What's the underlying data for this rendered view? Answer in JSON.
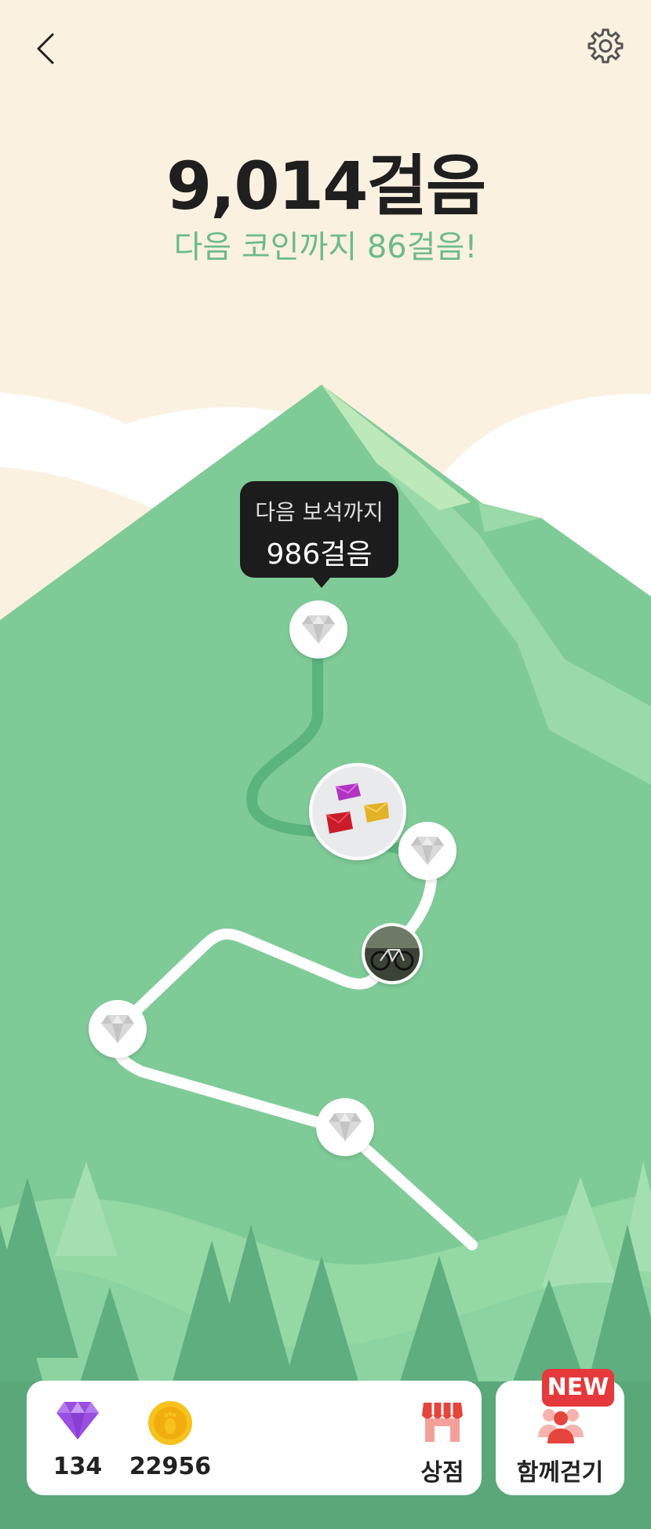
{
  "header": {
    "back_icon": "chevron-left-icon",
    "settings_icon": "gear-icon",
    "steps": "9,014걸음",
    "coin_message": "다음 코인까지 86걸음!"
  },
  "tooltip": {
    "line1": "다음 보석까지",
    "line2": "986걸음"
  },
  "path_nodes": [
    {
      "type": "gem",
      "state": "locked"
    },
    {
      "type": "photo",
      "subject": "colorful pouches"
    },
    {
      "type": "gem",
      "state": "locked"
    },
    {
      "type": "photo",
      "subject": "bicycle"
    },
    {
      "type": "gem",
      "state": "locked"
    },
    {
      "type": "gem",
      "state": "locked"
    }
  ],
  "bottom_bar": {
    "gems": "134",
    "coins": "22956",
    "shop_label": "상점",
    "walk_together_label": "함께걷기",
    "new_badge": "NEW"
  },
  "colors": {
    "sky": "#fbf1e0",
    "mountain": "#7fcb97",
    "gem_purple": "#9b4fe0",
    "coin_gold": "#f6c21c",
    "badge_red": "#e5393b",
    "accent_green": "#6dba8b"
  }
}
